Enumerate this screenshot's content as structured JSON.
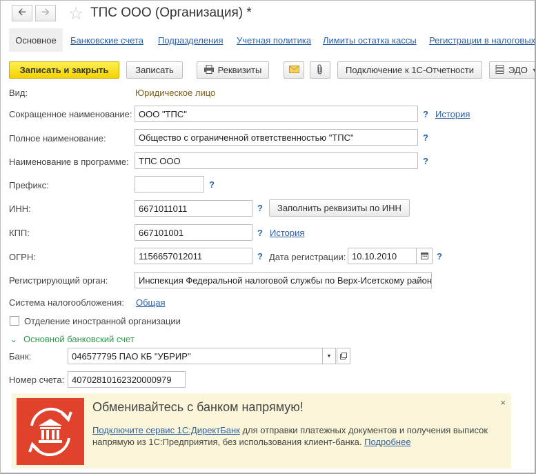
{
  "window": {
    "title": "ТПС ООО (Организация) *"
  },
  "tabs": [
    {
      "label": "Основное",
      "active": true
    },
    {
      "label": "Банковские счета"
    },
    {
      "label": "Подразделения"
    },
    {
      "label": "Учетная политика"
    },
    {
      "label": "Лимиты остатка кассы"
    },
    {
      "label": "Регистрации в налоговых"
    }
  ],
  "toolbar": {
    "save_close": "Записать и закрыть",
    "save": "Записать",
    "requisites": "Реквизиты",
    "connect": "Подключение к 1С-Отчетности",
    "edo": "ЭДО"
  },
  "form": {
    "vid_label": "Вид:",
    "vid_value": "Юридическое лицо",
    "short_label": "Сокращенное наименование:",
    "short_value": "ООО \"ТПС\"",
    "short_history": "История",
    "full_label": "Полное наименование:",
    "full_value": "Общество с ограниченной ответственностью \"ТПС\"",
    "prog_label": "Наименование в программе:",
    "prog_value": "ТПС ООО",
    "prefix_label": "Префикс:",
    "prefix_value": "",
    "inn_label": "ИНН:",
    "inn_value": "6671011011",
    "fill_by_inn": "Заполнить реквизиты по ИНН",
    "kpp_label": "КПП:",
    "kpp_value": "667101001",
    "kpp_history": "История",
    "ogrn_label": "ОГРН:",
    "ogrn_value": "1156657012011",
    "reg_date_label": "Дата регистрации:",
    "reg_date_value": "10.10.2010",
    "reg_org_label": "Регистрирующий орган:",
    "reg_org_value": "Инспекция Федеральной налоговой службы по Верх-Исетскому району",
    "tax_label": "Система налогообложения:",
    "tax_value": "Общая",
    "foreign_label": "Отделение иностранной организации",
    "question_mark": "?"
  },
  "bank_section": {
    "title": "Основной банковский счет",
    "bank_label": "Банк:",
    "bank_value": "046577795 ПАО КБ \"УБРИР\"",
    "account_label": "Номер счета:",
    "account_value": "40702810162320000979"
  },
  "banner": {
    "title": "Обменивайтесь с банком напрямую!",
    "link_connect": "Подключите сервис 1С:ДиректБанк",
    "text": " для отправки платежных документов и получения выписок напрямую из 1С:Предприятия, без использования клиент-банка. ",
    "link_more": "Подробнее",
    "close": "×"
  },
  "icons": {
    "back": "arrow-left-icon",
    "forward": "arrow-right-icon",
    "favorite": "star-icon",
    "print": "printer-icon",
    "mail": "envelope-icon",
    "attach": "paperclip-icon",
    "edo": "document-exchange-icon",
    "calendar": "calendar-icon",
    "dropdown": "chevron-down-icon",
    "open": "open-form-icon",
    "bank": "bank-exchange-icon"
  },
  "colors": {
    "accent": "#f2d200",
    "link": "#2b5fa5",
    "section": "#2e9a4a",
    "banner_bg": "#fbf6d9",
    "banner_icon": "#e0422c"
  }
}
